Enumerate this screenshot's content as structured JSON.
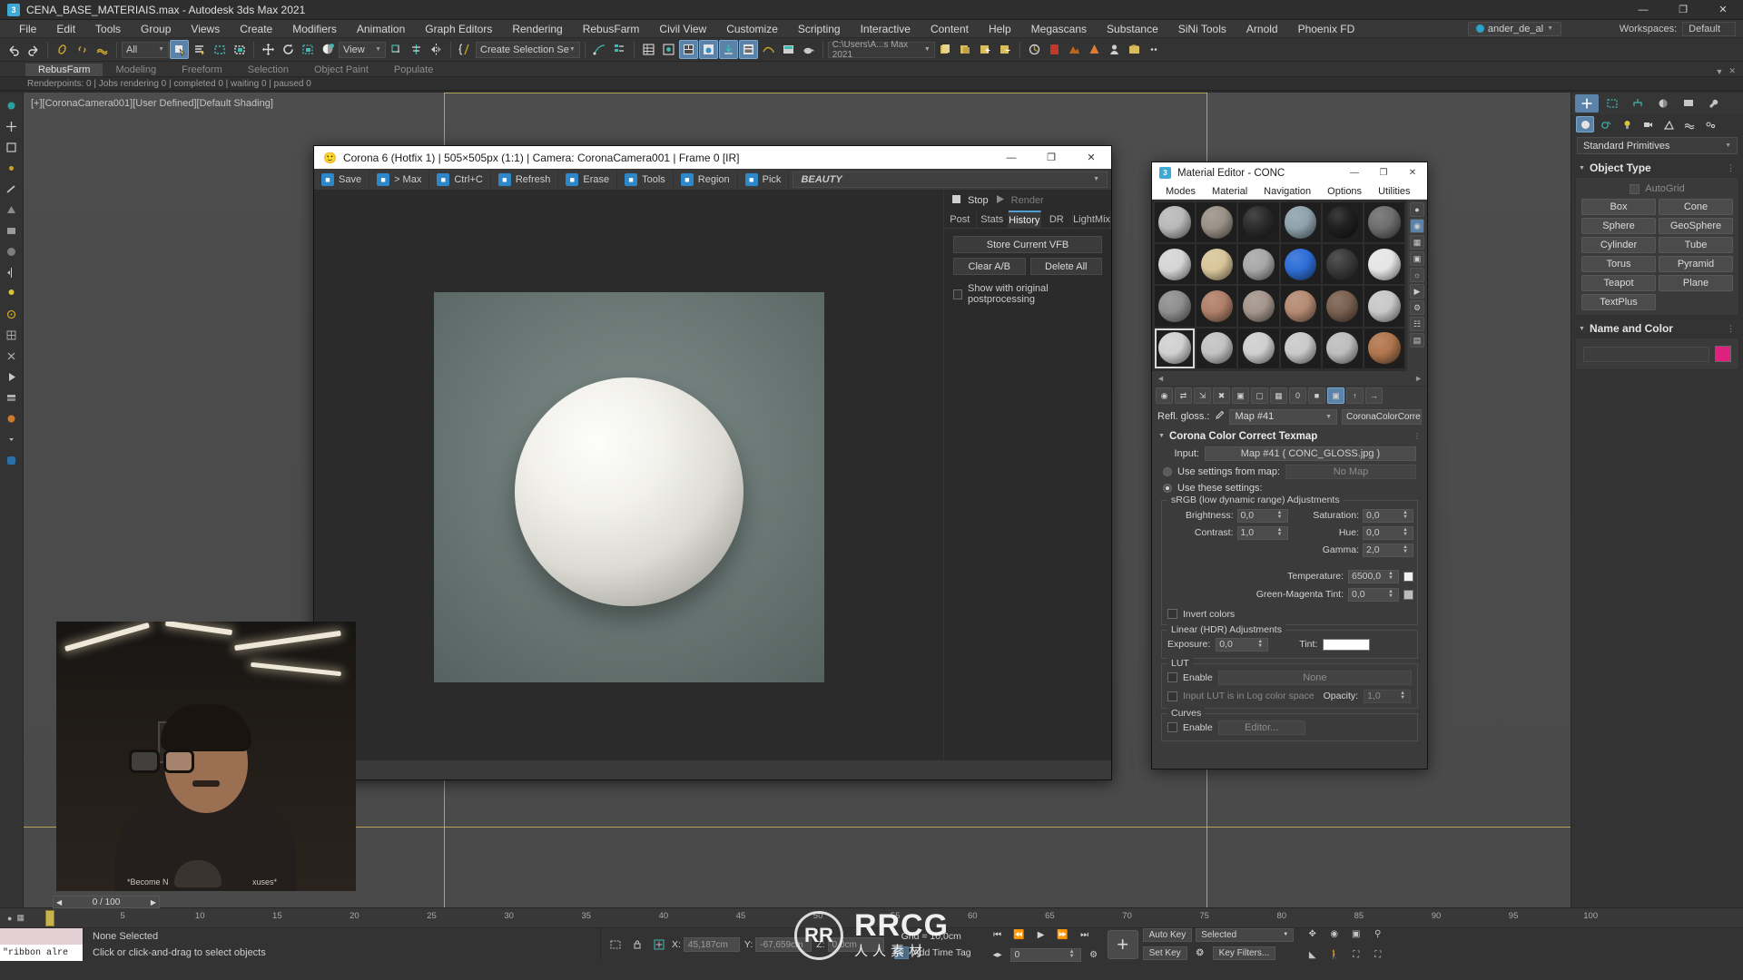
{
  "window": {
    "title": "CENA_BASE_MATERIAIS.max - Autodesk 3ds Max 2021",
    "app_icon": "3ds-max-icon",
    "minimize": "—",
    "maximize": "❐",
    "close": "✕"
  },
  "menubar": {
    "items": [
      "File",
      "Edit",
      "Tools",
      "Group",
      "Views",
      "Create",
      "Modifiers",
      "Animation",
      "Graph Editors",
      "Rendering",
      "RebusFarm",
      "Civil View",
      "Customize",
      "Scripting",
      "Interactive",
      "Content",
      "Help",
      "Megascans",
      "Substance",
      "SiNi Tools",
      "Arnold",
      "Phoenix FD"
    ],
    "user": "ander_de_al",
    "workspaces_label": "Workspaces:",
    "workspace_value": "Default"
  },
  "toolbar": {
    "selection_filter": "All",
    "reference_coord": "View",
    "named_selection_set": "Create Selection Se",
    "project_path": "C:\\Users\\A...s Max 2021"
  },
  "ribbon": {
    "tabs": [
      "RebusFarm",
      "Modeling",
      "Freeform",
      "Selection",
      "Object Paint",
      "Populate"
    ],
    "active": "RebusFarm"
  },
  "rebus_status": "Renderpoints: 0 | Jobs rendering 0 | completed 0 | waiting 0 | paused 0",
  "viewport": {
    "label": "[+][CoronaCamera001][User Defined][Default Shading]"
  },
  "vfb": {
    "title": "Corona 6 (Hotfix 1) | 505×505px (1:1) | Camera: CoronaCamera001 | Frame 0 [IR]",
    "toolbar": [
      {
        "label": "Save",
        "icon": "save-icon"
      },
      {
        "label": "> Max",
        "icon": "send-to-max-icon"
      },
      {
        "label": "Ctrl+C",
        "icon": "copy-icon"
      },
      {
        "label": "Refresh",
        "icon": "refresh-icon"
      },
      {
        "label": "Erase",
        "icon": "erase-icon"
      },
      {
        "label": "Tools",
        "icon": "tools-icon"
      },
      {
        "label": "Region",
        "icon": "region-icon"
      },
      {
        "label": "Pick",
        "icon": "pick-icon"
      }
    ],
    "pass": "BEAUTY",
    "stop_label": "Stop",
    "render_label": "Render",
    "tabs": [
      "Post",
      "Stats",
      "History",
      "DR",
      "LightMix"
    ],
    "active_tab": "History",
    "history": {
      "store_button": "Store Current VFB",
      "clear_button": "Clear A/B",
      "delete_button": "Delete All",
      "checkbox_label": "Show with original postprocessing",
      "checkbox_checked": false
    },
    "minimize": "—",
    "maximize": "❐",
    "close": "✕"
  },
  "material_editor": {
    "title": "Material Editor - CONC",
    "menu": [
      "Modes",
      "Material",
      "Navigation",
      "Options",
      "Utilities"
    ],
    "nav_left": "◄",
    "nav_right": "►",
    "slot_colors": [
      [
        "#b9b9b9",
        "#9a9287",
        "#2c2c2c",
        "#8fa2ad",
        "#201f1f",
        "#6e6e6e"
      ],
      [
        "#d5d5d5",
        "#d8c59a",
        "#a8a8a8",
        "#2f6ed6",
        "#3a3a3a",
        "#e5e5e5"
      ],
      [
        "#8e8e8e",
        "#b0806a",
        "#a4968c",
        "#b58a72",
        "#7a6050",
        "#c8c8c8"
      ],
      [
        "#d0d0d0",
        "#c2c2c2",
        "#cfcfcf",
        "#c9c9c9",
        "#bdbdbd",
        "#b0764e"
      ]
    ],
    "selected_slot": [
      3,
      0
    ],
    "refl_gloss": {
      "label": "Refl. gloss.:",
      "map": "Map #41",
      "type": "CoronaColorCorre"
    },
    "rollout_title": "Corona Color Correct Texmap",
    "input": {
      "label": "Input:",
      "value": "Map #41 ( CONC_GLOSS.jpg )"
    },
    "use_settings_from_map": {
      "label": "Use settings from map:",
      "value": "No Map",
      "selected": false
    },
    "use_these_settings": {
      "label": "Use these settings:",
      "selected": true
    },
    "srgb_group": "sRGB (low dynamic range) Adjustments",
    "srgb_fields": [
      {
        "label": "Brightness:",
        "value": "0,0"
      },
      {
        "label": "Contrast:",
        "value": "1,0"
      },
      {
        "label": "Saturation:",
        "value": "0,0"
      },
      {
        "label": "Hue:",
        "value": "0,0"
      },
      {
        "label": "Gamma:",
        "value": "2,0"
      }
    ],
    "temperature": {
      "label": "Temperature:",
      "value": "6500,0",
      "swatch": "#f2f2f2"
    },
    "green_magenta": {
      "label": "Green-Magenta Tint:",
      "value": "0,0",
      "swatch": "#bdbdbd"
    },
    "invert_colors": {
      "label": "Invert colors",
      "checked": false
    },
    "linear_group": "Linear (HDR) Adjustments",
    "exposure": {
      "label": "Exposure:",
      "value": "0,0"
    },
    "tint": {
      "label": "Tint:",
      "swatch": "#ffffff"
    },
    "lut_group": "LUT",
    "lut_enable": {
      "label": "Enable",
      "value": "None",
      "checked": false
    },
    "lut_log": {
      "label": "Input LUT is in Log color space",
      "checked": false
    },
    "lut_opacity": {
      "label": "Opacity:",
      "value": "1,0"
    },
    "curves_group": "Curves",
    "curves_enable": {
      "label": "Enable",
      "button": "Editor...",
      "checked": false
    },
    "minimize": "—",
    "maximize": "❐",
    "close": "✕"
  },
  "command_panel": {
    "category": "Standard Primitives",
    "object_type_title": "Object Type",
    "autogrid": "AutoGrid",
    "buttons": [
      "Box",
      "Cone",
      "Sphere",
      "GeoSphere",
      "Cylinder",
      "Tube",
      "Torus",
      "Pyramid",
      "Teapot",
      "Plane",
      "TextPlus"
    ],
    "name_color_title": "Name and Color",
    "object_color": "#e0207f"
  },
  "timeline": {
    "frame_display": "0 / 100",
    "ticks": [
      "5",
      "10",
      "15",
      "20",
      "25",
      "30",
      "35",
      "40",
      "45",
      "50",
      "55",
      "60",
      "65",
      "70",
      "75",
      "80",
      "85",
      "90",
      "95",
      "100"
    ]
  },
  "statusbar": {
    "maxscript_text": "\"ribbon alre",
    "selection": "None Selected",
    "prompt": "Click or click-and-drag to select objects",
    "x": {
      "label": "X:",
      "value": "45,187cm"
    },
    "y": {
      "label": "Y:",
      "value": "-67,659cm"
    },
    "z": {
      "label": "Z:",
      "value": "0,0cm"
    },
    "grid": "Grid = 10,0cm",
    "add_time_tag": "Add Time Tag",
    "auto_key": "Auto Key",
    "set_key": "Set Key",
    "key_filters": "Key Filters...",
    "selected_combo": "Selected",
    "key_frame_value": "0"
  },
  "watermark": {
    "logo": "RR",
    "text": "RRCG",
    "sub": "人人素材"
  }
}
